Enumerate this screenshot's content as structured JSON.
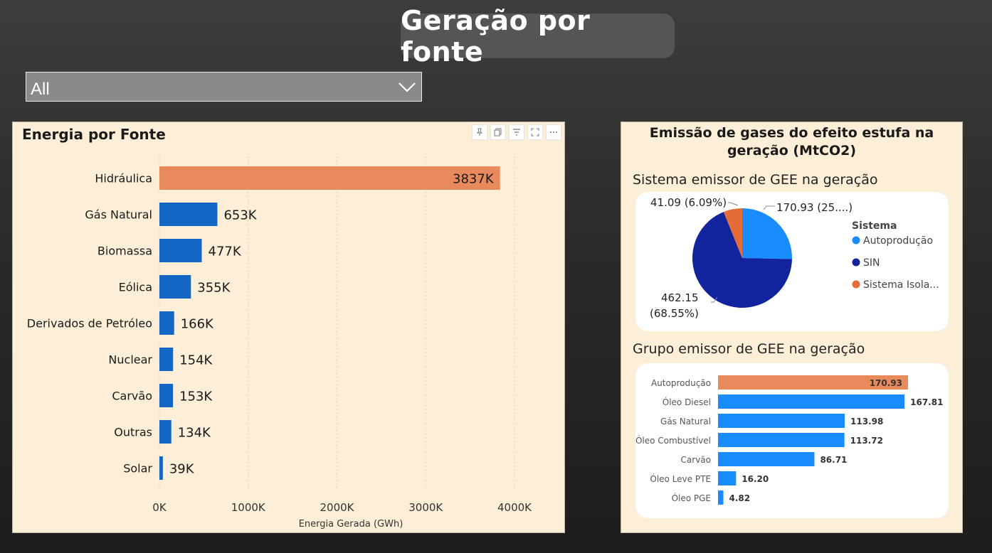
{
  "header": {
    "title": "Geração por fonte"
  },
  "slicer": {
    "value": "All"
  },
  "left_panel": {
    "title": "Energia por Fonte",
    "toolbar_icons": [
      "pin-icon",
      "copy-icon",
      "filter-icon",
      "focus-icon",
      "more-icon"
    ]
  },
  "right_panel": {
    "title_line1": "Emissão de gases do efeito estufa na",
    "title_line2": "geração (MtCO2)",
    "pie_section_title": "Sistema emissor de GEE na geração",
    "bar_section_title": "Grupo emissor de GEE na geração"
  },
  "chart_data": [
    {
      "type": "bar",
      "orientation": "horizontal",
      "title": "Energia por Fonte",
      "xlabel": "Energia Gerada (GWh)",
      "ylabel": "",
      "xlim": [
        0,
        4000
      ],
      "x_ticks": [
        "0K",
        "1000K",
        "2000K",
        "3000K",
        "4000K"
      ],
      "grid": true,
      "categories": [
        "Hidráulica",
        "Gás Natural",
        "Biomassa",
        "Eólica",
        "Derivados de Petróleo",
        "Nuclear",
        "Carvão",
        "Outras",
        "Solar"
      ],
      "values": [
        3837,
        653,
        477,
        355,
        166,
        154,
        153,
        134,
        39
      ],
      "data_labels": [
        "3837K",
        "653K",
        "477K",
        "355K",
        "166K",
        "154K",
        "153K",
        "134K",
        "39K"
      ],
      "colors": [
        "#e98a5d",
        "#1366c4",
        "#1366c4",
        "#1366c4",
        "#1366c4",
        "#1366c4",
        "#1366c4",
        "#1366c4",
        "#1366c4"
      ]
    },
    {
      "type": "pie",
      "title": "Sistema emissor de GEE na geração",
      "legend_title": "Sistema",
      "legend_position": "right",
      "labels": [
        "Autoprodução",
        "SIN",
        "Sistema Isola..."
      ],
      "values": [
        170.93,
        462.15,
        41.09
      ],
      "colors": [
        "#198cff",
        "#12239e",
        "#e66c37"
      ],
      "data_labels": [
        "170.93 (25....)",
        "462.15",
        "(68.55%)",
        "41.09 (6.09%)"
      ]
    },
    {
      "type": "bar",
      "orientation": "horizontal",
      "title": "Grupo emissor de GEE na geração",
      "categories": [
        "Autoprodução",
        "Óleo Diesel",
        "Gás Natural",
        "Óleo Combustível",
        "Carvão",
        "Óleo Leve PTE",
        "Óleo PGE"
      ],
      "values": [
        170.93,
        167.81,
        113.98,
        113.72,
        86.71,
        16.2,
        4.82
      ],
      "data_labels": [
        "170.93",
        "167.81",
        "113.98",
        "113.72",
        "86.71",
        "16.20",
        "4.82"
      ],
      "colors": [
        "#e98a5d",
        "#198cff",
        "#198cff",
        "#198cff",
        "#198cff",
        "#198cff",
        "#198cff"
      ]
    }
  ]
}
